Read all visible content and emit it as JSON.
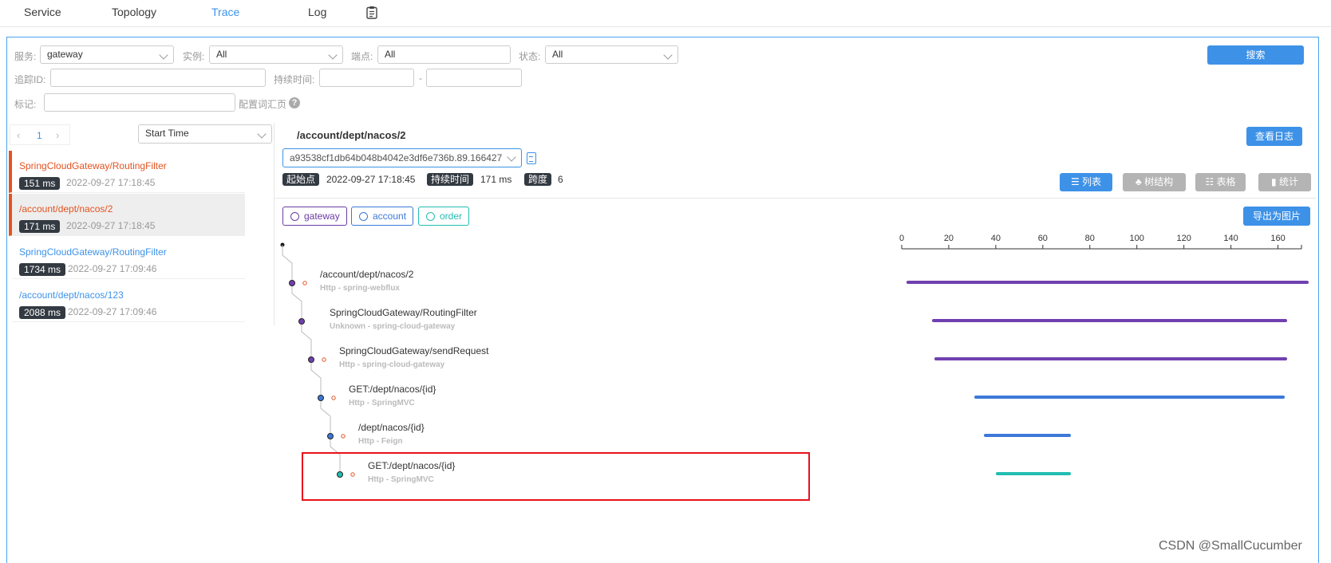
{
  "nav": {
    "items": [
      {
        "label": "Service"
      },
      {
        "label": "Topology"
      },
      {
        "label": "Trace"
      },
      {
        "label": "Log"
      }
    ]
  },
  "filters": {
    "service_label": "服务:",
    "service_value": "gateway",
    "instance_label": "实例:",
    "instance_value": "All",
    "endpoint_label": "端点:",
    "endpoint_value": "All",
    "status_label": "状态:",
    "status_value": "All",
    "traceid_label": "追踪ID:",
    "duration_label": "持续时间:",
    "duration_dash": "-",
    "tags_label": "标记:",
    "config_link": "配置词汇页",
    "search_button": "搜索"
  },
  "list": {
    "page": "1",
    "sort_value": "Start Time",
    "items": [
      {
        "name": "SpringCloudGateway/RoutingFilter",
        "duration": "151 ms",
        "time": "2022-09-27 17:18:45"
      },
      {
        "name": "/account/dept/nacos/2",
        "duration": "171 ms",
        "time": "2022-09-27 17:18:45"
      },
      {
        "name": "SpringCloudGateway/RoutingFilter",
        "duration": "1734 ms",
        "time": "2022-09-27 17:09:46"
      },
      {
        "name": "/account/dept/nacos/123",
        "duration": "2088 ms",
        "time": "2022-09-27 17:09:46"
      }
    ]
  },
  "detail": {
    "title": "/account/dept/nacos/2",
    "view_logs_button": "查看日志",
    "trace_id": "a93538cf1db64b048b4042e3df6e736b.89.166427",
    "start_label": "起始点",
    "start_value": "2022-09-27 17:18:45",
    "duration_label": "持续时间",
    "duration_value": "171 ms",
    "span_label": "跨度",
    "span_value": "6",
    "views": [
      "列表",
      "树结构",
      "表格",
      "统计"
    ],
    "export_button": "导出为图片",
    "services": [
      {
        "name": "gateway",
        "color": "#6a3ba5"
      },
      {
        "name": "account",
        "color": "#3d78d8"
      },
      {
        "name": "order",
        "color": "#22bdb0"
      }
    ],
    "axis_ticks": [
      "0",
      "20",
      "40",
      "60",
      "80",
      "100",
      "120",
      "140",
      "160"
    ],
    "spans": [
      {
        "name": "/account/dept/nacos/2",
        "sub": "Http - spring-webflux",
        "start": 2,
        "end": 173,
        "color": "#7040b0"
      },
      {
        "name": "SpringCloudGateway/RoutingFilter",
        "sub": "Unknown - spring-cloud-gateway",
        "start": 13,
        "end": 164,
        "color": "#7040b0"
      },
      {
        "name": "SpringCloudGateway/sendRequest",
        "sub": "Http - spring-cloud-gateway",
        "start": 14,
        "end": 164,
        "color": "#7040b0"
      },
      {
        "name": "GET:/dept/nacos/{id}",
        "sub": "Http - SpringMVC",
        "start": 31,
        "end": 163,
        "color": "#3d78d8"
      },
      {
        "name": "/dept/nacos/{id}",
        "sub": "Http - Feign",
        "start": 35,
        "end": 72,
        "color": "#3d78d8"
      },
      {
        "name": "GET:/dept/nacos/{id}",
        "sub": "Http - SpringMVC",
        "start": 40,
        "end": 72,
        "color": "#22bdb0"
      }
    ]
  },
  "watermark": "CSDN @SmallCucumber"
}
